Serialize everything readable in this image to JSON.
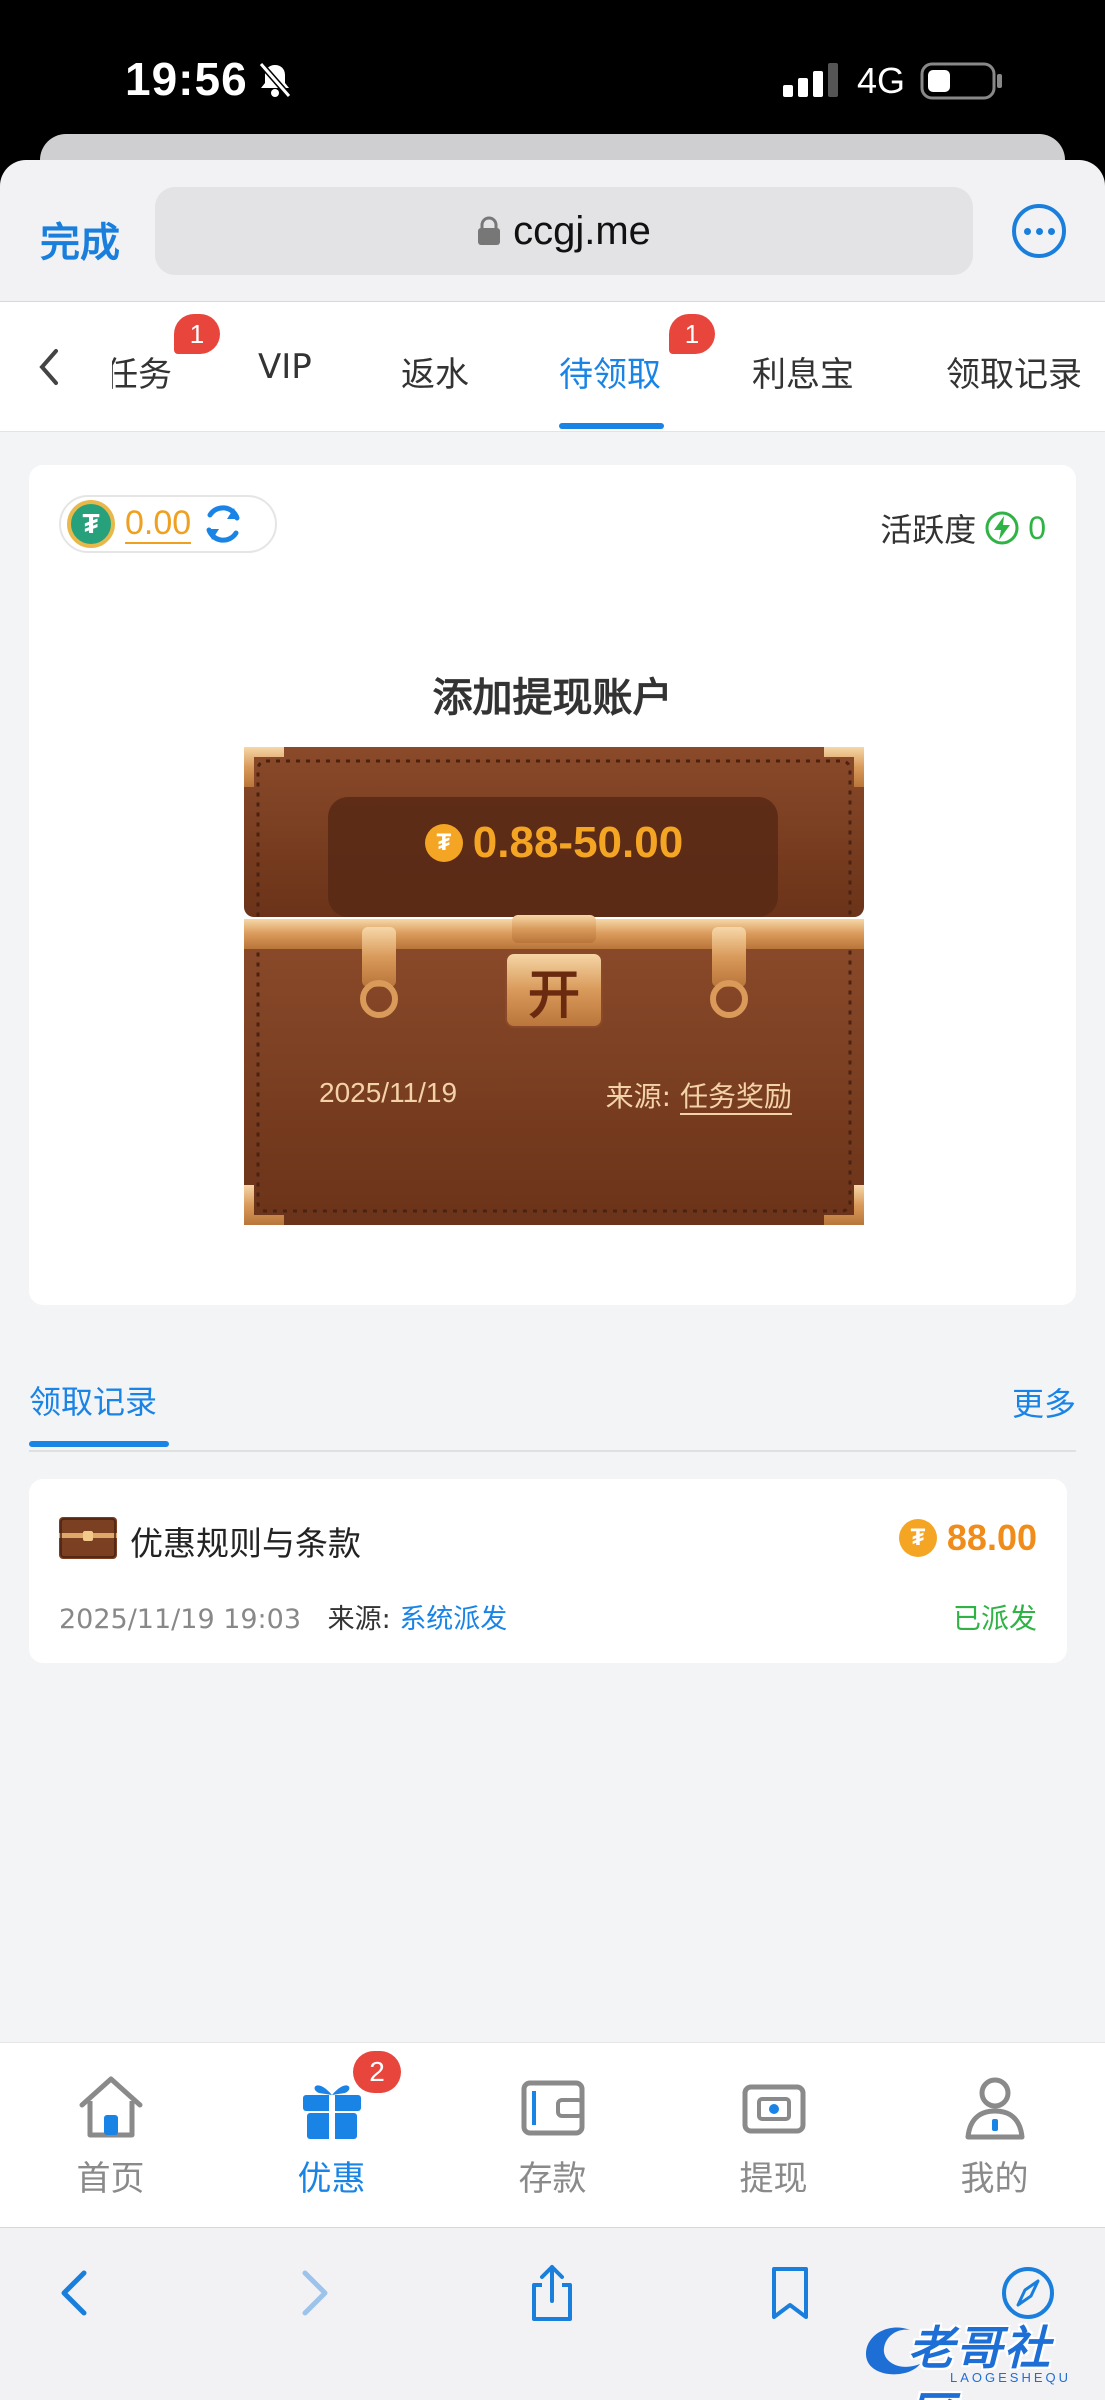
{
  "status_bar": {
    "time": "19:56",
    "network": "4G"
  },
  "browser": {
    "done_label": "完成",
    "url": "ccgj.me"
  },
  "tabs": [
    {
      "label": "任务",
      "badge": "1"
    },
    {
      "label": "VIP"
    },
    {
      "label": "返水"
    },
    {
      "label": "待领取",
      "badge": "1",
      "active": true
    },
    {
      "label": "利息宝"
    },
    {
      "label": "领取记录"
    }
  ],
  "wallet": {
    "balance": "0.00",
    "activity_label": "活跃度",
    "activity_value": "0"
  },
  "reward_card": {
    "title": "添加提现账户",
    "amount_range": "0.88-50.00",
    "open_label": "开",
    "date": "2025/11/19",
    "source_label": "来源:",
    "source_value": "任务奖励"
  },
  "records": {
    "title": "领取记录",
    "more_label": "更多",
    "items": [
      {
        "name": "优惠规则与条款",
        "amount": "88.00",
        "datetime": "2025/11/19 19:03",
        "source_label": "来源:",
        "source_value": "系统派发",
        "status": "已派发"
      }
    ]
  },
  "bottom_nav": [
    {
      "label": "首页",
      "icon": "home-icon"
    },
    {
      "label": "优惠",
      "icon": "gift-icon",
      "badge": "2",
      "active": true
    },
    {
      "label": "存款",
      "icon": "wallet-icon"
    },
    {
      "label": "提现",
      "icon": "withdraw-icon"
    },
    {
      "label": "我的",
      "icon": "user-icon"
    }
  ],
  "watermark": {
    "text": "老哥社区",
    "sub": "LAOGESHEQU"
  },
  "colors": {
    "accent": "#1a84e6",
    "coin_orange": "#f5a524",
    "badge_red": "#e8453c",
    "success": "#2fb344",
    "chest_brown": "#7b3f22"
  }
}
